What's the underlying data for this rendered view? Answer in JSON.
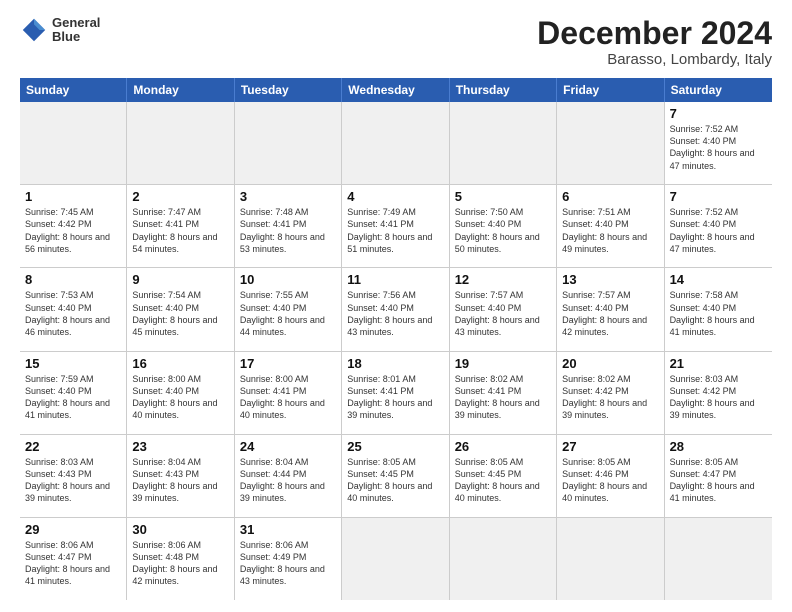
{
  "header": {
    "logo_line1": "General",
    "logo_line2": "Blue",
    "main_title": "December 2024",
    "subtitle": "Barasso, Lombardy, Italy"
  },
  "calendar": {
    "days": [
      "Sunday",
      "Monday",
      "Tuesday",
      "Wednesday",
      "Thursday",
      "Friday",
      "Saturday"
    ],
    "weeks": [
      [
        {
          "day": "",
          "empty": true
        },
        {
          "day": "",
          "empty": true
        },
        {
          "day": "",
          "empty": true
        },
        {
          "day": "",
          "empty": true
        },
        {
          "day": "",
          "empty": true
        },
        {
          "day": "",
          "empty": true
        },
        {
          "day": "",
          "empty": true
        }
      ]
    ],
    "cells": [
      [
        {
          "num": "",
          "empty": true,
          "shaded": true
        },
        {
          "num": "",
          "empty": true,
          "shaded": true
        },
        {
          "num": "",
          "empty": true,
          "shaded": true
        },
        {
          "num": "",
          "empty": true,
          "shaded": true
        },
        {
          "num": "",
          "empty": true,
          "shaded": true
        },
        {
          "num": "",
          "empty": true,
          "shaded": true
        },
        {
          "num": "7",
          "sunrise": "Sunrise: 7:52 AM",
          "sunset": "Sunset: 4:40 PM",
          "daylight": "Daylight: 8 hours and 47 minutes."
        }
      ],
      [
        {
          "num": "1",
          "sunrise": "Sunrise: 7:45 AM",
          "sunset": "Sunset: 4:42 PM",
          "daylight": "Daylight: 8 hours and 56 minutes."
        },
        {
          "num": "2",
          "sunrise": "Sunrise: 7:47 AM",
          "sunset": "Sunset: 4:41 PM",
          "daylight": "Daylight: 8 hours and 54 minutes."
        },
        {
          "num": "3",
          "sunrise": "Sunrise: 7:48 AM",
          "sunset": "Sunset: 4:41 PM",
          "daylight": "Daylight: 8 hours and 53 minutes."
        },
        {
          "num": "4",
          "sunrise": "Sunrise: 7:49 AM",
          "sunset": "Sunset: 4:41 PM",
          "daylight": "Daylight: 8 hours and 51 minutes."
        },
        {
          "num": "5",
          "sunrise": "Sunrise: 7:50 AM",
          "sunset": "Sunset: 4:40 PM",
          "daylight": "Daylight: 8 hours and 50 minutes."
        },
        {
          "num": "6",
          "sunrise": "Sunrise: 7:51 AM",
          "sunset": "Sunset: 4:40 PM",
          "daylight": "Daylight: 8 hours and 49 minutes."
        },
        {
          "num": "7",
          "sunrise": "Sunrise: 7:52 AM",
          "sunset": "Sunset: 4:40 PM",
          "daylight": "Daylight: 8 hours and 47 minutes."
        }
      ],
      [
        {
          "num": "8",
          "sunrise": "Sunrise: 7:53 AM",
          "sunset": "Sunset: 4:40 PM",
          "daylight": "Daylight: 8 hours and 46 minutes."
        },
        {
          "num": "9",
          "sunrise": "Sunrise: 7:54 AM",
          "sunset": "Sunset: 4:40 PM",
          "daylight": "Daylight: 8 hours and 45 minutes."
        },
        {
          "num": "10",
          "sunrise": "Sunrise: 7:55 AM",
          "sunset": "Sunset: 4:40 PM",
          "daylight": "Daylight: 8 hours and 44 minutes."
        },
        {
          "num": "11",
          "sunrise": "Sunrise: 7:56 AM",
          "sunset": "Sunset: 4:40 PM",
          "daylight": "Daylight: 8 hours and 43 minutes."
        },
        {
          "num": "12",
          "sunrise": "Sunrise: 7:57 AM",
          "sunset": "Sunset: 4:40 PM",
          "daylight": "Daylight: 8 hours and 43 minutes."
        },
        {
          "num": "13",
          "sunrise": "Sunrise: 7:57 AM",
          "sunset": "Sunset: 4:40 PM",
          "daylight": "Daylight: 8 hours and 42 minutes."
        },
        {
          "num": "14",
          "sunrise": "Sunrise: 7:58 AM",
          "sunset": "Sunset: 4:40 PM",
          "daylight": "Daylight: 8 hours and 41 minutes."
        }
      ],
      [
        {
          "num": "15",
          "sunrise": "Sunrise: 7:59 AM",
          "sunset": "Sunset: 4:40 PM",
          "daylight": "Daylight: 8 hours and 41 minutes."
        },
        {
          "num": "16",
          "sunrise": "Sunrise: 8:00 AM",
          "sunset": "Sunset: 4:40 PM",
          "daylight": "Daylight: 8 hours and 40 minutes."
        },
        {
          "num": "17",
          "sunrise": "Sunrise: 8:00 AM",
          "sunset": "Sunset: 4:41 PM",
          "daylight": "Daylight: 8 hours and 40 minutes."
        },
        {
          "num": "18",
          "sunrise": "Sunrise: 8:01 AM",
          "sunset": "Sunset: 4:41 PM",
          "daylight": "Daylight: 8 hours and 39 minutes."
        },
        {
          "num": "19",
          "sunrise": "Sunrise: 8:02 AM",
          "sunset": "Sunset: 4:41 PM",
          "daylight": "Daylight: 8 hours and 39 minutes."
        },
        {
          "num": "20",
          "sunrise": "Sunrise: 8:02 AM",
          "sunset": "Sunset: 4:42 PM",
          "daylight": "Daylight: 8 hours and 39 minutes."
        },
        {
          "num": "21",
          "sunrise": "Sunrise: 8:03 AM",
          "sunset": "Sunset: 4:42 PM",
          "daylight": "Daylight: 8 hours and 39 minutes."
        }
      ],
      [
        {
          "num": "22",
          "sunrise": "Sunrise: 8:03 AM",
          "sunset": "Sunset: 4:43 PM",
          "daylight": "Daylight: 8 hours and 39 minutes."
        },
        {
          "num": "23",
          "sunrise": "Sunrise: 8:04 AM",
          "sunset": "Sunset: 4:43 PM",
          "daylight": "Daylight: 8 hours and 39 minutes."
        },
        {
          "num": "24",
          "sunrise": "Sunrise: 8:04 AM",
          "sunset": "Sunset: 4:44 PM",
          "daylight": "Daylight: 8 hours and 39 minutes."
        },
        {
          "num": "25",
          "sunrise": "Sunrise: 8:05 AM",
          "sunset": "Sunset: 4:45 PM",
          "daylight": "Daylight: 8 hours and 40 minutes."
        },
        {
          "num": "26",
          "sunrise": "Sunrise: 8:05 AM",
          "sunset": "Sunset: 4:45 PM",
          "daylight": "Daylight: 8 hours and 40 minutes."
        },
        {
          "num": "27",
          "sunrise": "Sunrise: 8:05 AM",
          "sunset": "Sunset: 4:46 PM",
          "daylight": "Daylight: 8 hours and 40 minutes."
        },
        {
          "num": "28",
          "sunrise": "Sunrise: 8:05 AM",
          "sunset": "Sunset: 4:47 PM",
          "daylight": "Daylight: 8 hours and 41 minutes."
        }
      ],
      [
        {
          "num": "29",
          "sunrise": "Sunrise: 8:06 AM",
          "sunset": "Sunset: 4:47 PM",
          "daylight": "Daylight: 8 hours and 41 minutes."
        },
        {
          "num": "30",
          "sunrise": "Sunrise: 8:06 AM",
          "sunset": "Sunset: 4:48 PM",
          "daylight": "Daylight: 8 hours and 42 minutes."
        },
        {
          "num": "31",
          "sunrise": "Sunrise: 8:06 AM",
          "sunset": "Sunset: 4:49 PM",
          "daylight": "Daylight: 8 hours and 43 minutes."
        },
        {
          "num": "",
          "empty": true,
          "shaded": true
        },
        {
          "num": "",
          "empty": true,
          "shaded": true
        },
        {
          "num": "",
          "empty": true,
          "shaded": true
        },
        {
          "num": "",
          "empty": true,
          "shaded": true
        }
      ]
    ]
  }
}
